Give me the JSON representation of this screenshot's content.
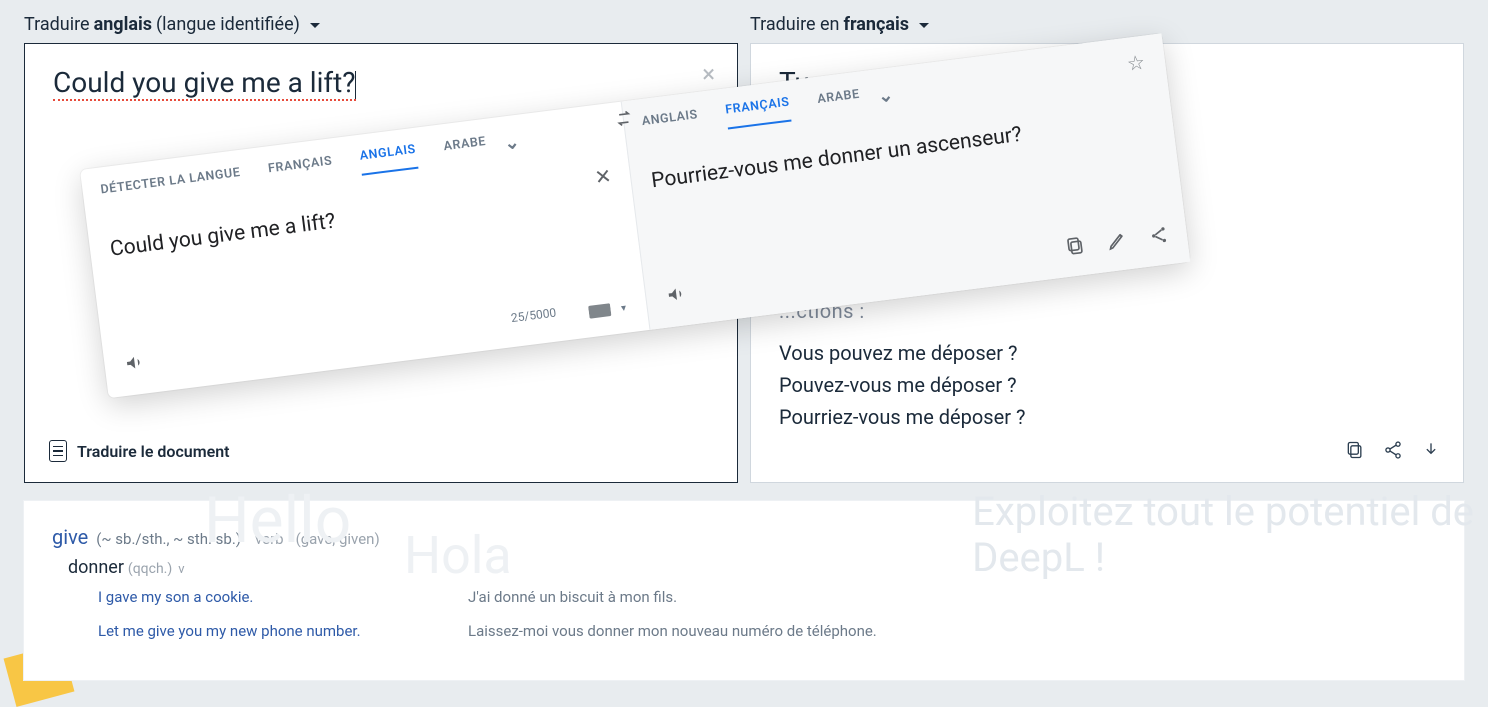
{
  "source": {
    "header_prefix": "Traduire ",
    "header_lang": "anglais",
    "header_suffix": " (langue identifiée)",
    "text": "Could you give me a lift?",
    "translate_doc": "Traduire le document"
  },
  "target": {
    "header_prefix": "Traduire en ",
    "header_lang": "français",
    "text": "Tu peux me déposer ?",
    "alt_header_fragment": "...ctions :",
    "alts": [
      "Vous pouvez me déposer ?",
      "Pouvez-vous me déposer ?",
      "Pourriez-vous me déposer ?"
    ]
  },
  "gt": {
    "left_tabs": [
      "DÉTECTER LA LANGUE",
      "FRANÇAIS",
      "ANGLAIS",
      "ARABE"
    ],
    "left_active_index": 2,
    "right_tabs": [
      "ANGLAIS",
      "FRANÇAIS",
      "ARABE"
    ],
    "right_active_index": 1,
    "left_text": "Could you give me a lift?",
    "right_text": "Pourriez-vous me donner un ascenseur?",
    "counter": "25/5000"
  },
  "dict": {
    "headword": "give",
    "grammar": "(~ sb./sth., ~ sth. sb.)",
    "pos": "verb",
    "forms": "(gave, given)",
    "sense_word": "donner",
    "sense_grammar": "(qqch.)",
    "sense_pos": "v",
    "examples": [
      {
        "en": "I gave my son a cookie.",
        "fr": "J'ai donné un biscuit à mon fils."
      },
      {
        "en": "Let me give you my new phone number.",
        "fr": "Laissez-moi vous donner mon nouveau numéro de téléphone."
      }
    ],
    "bg_hello": "Hello",
    "bg_hola": "Hola",
    "bg_promo_1": "Exploitez tout le potentiel de",
    "bg_promo_2": "DeepL !"
  }
}
